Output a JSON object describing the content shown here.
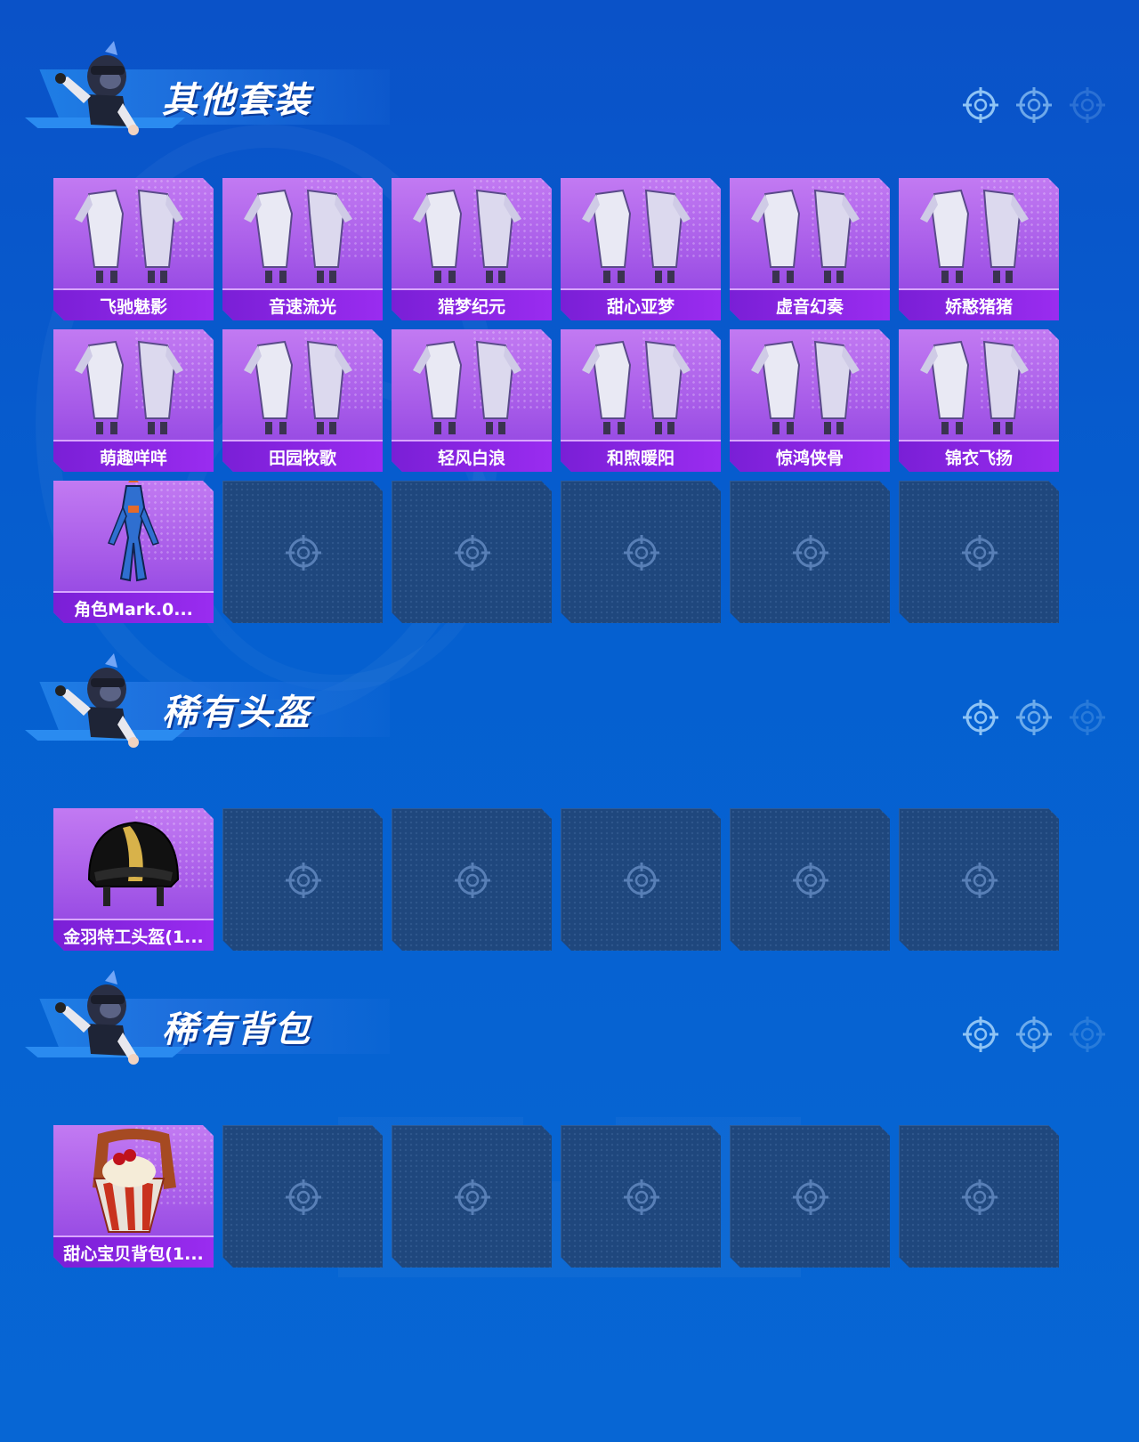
{
  "colors": {
    "background": "#0560d0",
    "card_purple": "#a65ae8",
    "label_bar": "#8a26e6",
    "empty_slot": "#1f477d",
    "crosshair": "#8fc4f5"
  },
  "sections": {
    "suits": {
      "title": "其他套装",
      "items": [
        {
          "label": "飞驰魅影",
          "icon": "outfit-icon"
        },
        {
          "label": "音速流光",
          "icon": "outfit-icon"
        },
        {
          "label": "猎梦纪元",
          "icon": "outfit-icon"
        },
        {
          "label": "甜心亚梦",
          "icon": "outfit-icon"
        },
        {
          "label": "虚音幻奏",
          "icon": "outfit-icon"
        },
        {
          "label": "娇憨猪猪",
          "icon": "outfit-icon"
        },
        {
          "label": "萌趣咩咩",
          "icon": "outfit-icon"
        },
        {
          "label": "田园牧歌",
          "icon": "outfit-icon"
        },
        {
          "label": "轻风白浪",
          "icon": "outfit-icon"
        },
        {
          "label": "和煦暖阳",
          "icon": "outfit-icon"
        },
        {
          "label": "惊鸿侠骨",
          "icon": "outfit-icon"
        },
        {
          "label": "锦衣飞扬",
          "icon": "outfit-icon"
        },
        {
          "label": "角色Mark.0...",
          "icon": "mech-suit-icon"
        }
      ],
      "empty_slots": 5
    },
    "helmets": {
      "title": "稀有头盔",
      "items": [
        {
          "label": "金羽特工头盔(1...",
          "icon": "helmet-icon"
        }
      ],
      "empty_slots": 5
    },
    "backpacks": {
      "title": "稀有背包",
      "items": [
        {
          "label": "甜心宝贝背包(1...",
          "icon": "backpack-icon"
        }
      ],
      "empty_slots": 5
    }
  }
}
